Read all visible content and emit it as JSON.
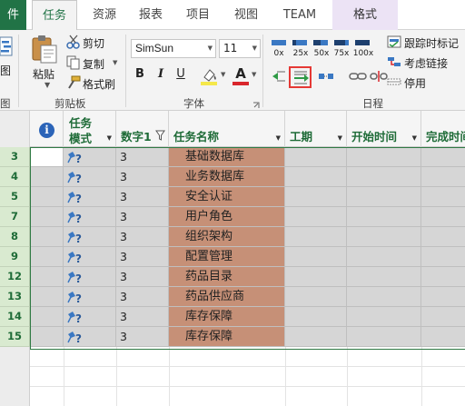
{
  "tabs": [
    {
      "label": "件",
      "kind": "file"
    },
    {
      "label": "任务",
      "kind": "active"
    },
    {
      "label": "资源",
      "kind": "normal"
    },
    {
      "label": "报表",
      "kind": "normal"
    },
    {
      "label": "项目",
      "kind": "normal"
    },
    {
      "label": "视图",
      "kind": "normal"
    },
    {
      "label": "TEAM",
      "kind": "normal"
    },
    {
      "label": "格式",
      "kind": "format"
    }
  ],
  "ribbon": {
    "view_partial_label": "图",
    "view_group_partial": "图",
    "clipboard": {
      "paste_label": "粘贴",
      "cut_label": "剪切",
      "copy_label": "复制",
      "format_painter_label": "格式刷",
      "group_label": "剪贴板"
    },
    "font": {
      "font_name": "SimSun",
      "font_size": "11",
      "bold": "B",
      "italic": "I",
      "underline": "U",
      "font_color_glyph": "A",
      "group_label": "字体",
      "highlight_color": "#f5e84a",
      "font_color": "#d9262c"
    },
    "schedule": {
      "percent_labels": [
        "0x",
        "25x",
        "50x",
        "75x",
        "100x"
      ],
      "respect_links_label": "跟踪时标记",
      "consider_links_label": "考虑链接",
      "inactivate_label": "停用",
      "group_label": "日程"
    }
  },
  "grid": {
    "headers": {
      "info": "i",
      "mode_line1": "任务",
      "mode_line2": "模式",
      "number1": "数字1",
      "task_name": "任务名称",
      "duration": "工期",
      "start": "开始时间",
      "finish": "完成时间"
    },
    "rows": [
      {
        "id": "3",
        "number1": "3",
        "name": "基础数据库"
      },
      {
        "id": "4",
        "number1": "3",
        "name": "业务数据库"
      },
      {
        "id": "5",
        "number1": "3",
        "name": "安全认证"
      },
      {
        "id": "7",
        "number1": "3",
        "name": "用户角色"
      },
      {
        "id": "8",
        "number1": "3",
        "name": "组织架构"
      },
      {
        "id": "9",
        "number1": "3",
        "name": "配置管理"
      },
      {
        "id": "12",
        "number1": "3",
        "name": "药品目录"
      },
      {
        "id": "13",
        "number1": "3",
        "name": "药品供应商"
      },
      {
        "id": "14",
        "number1": "3",
        "name": "库存保障"
      },
      {
        "id": "15",
        "number1": "3",
        "name": "库存保障"
      }
    ]
  },
  "colors": {
    "accent_green": "#217346",
    "task_name_fill": "#c69077",
    "selected_row_fill": "#d6d6d6",
    "row_header_fill": "#d9ead0",
    "highlight_box": "#e53935"
  }
}
